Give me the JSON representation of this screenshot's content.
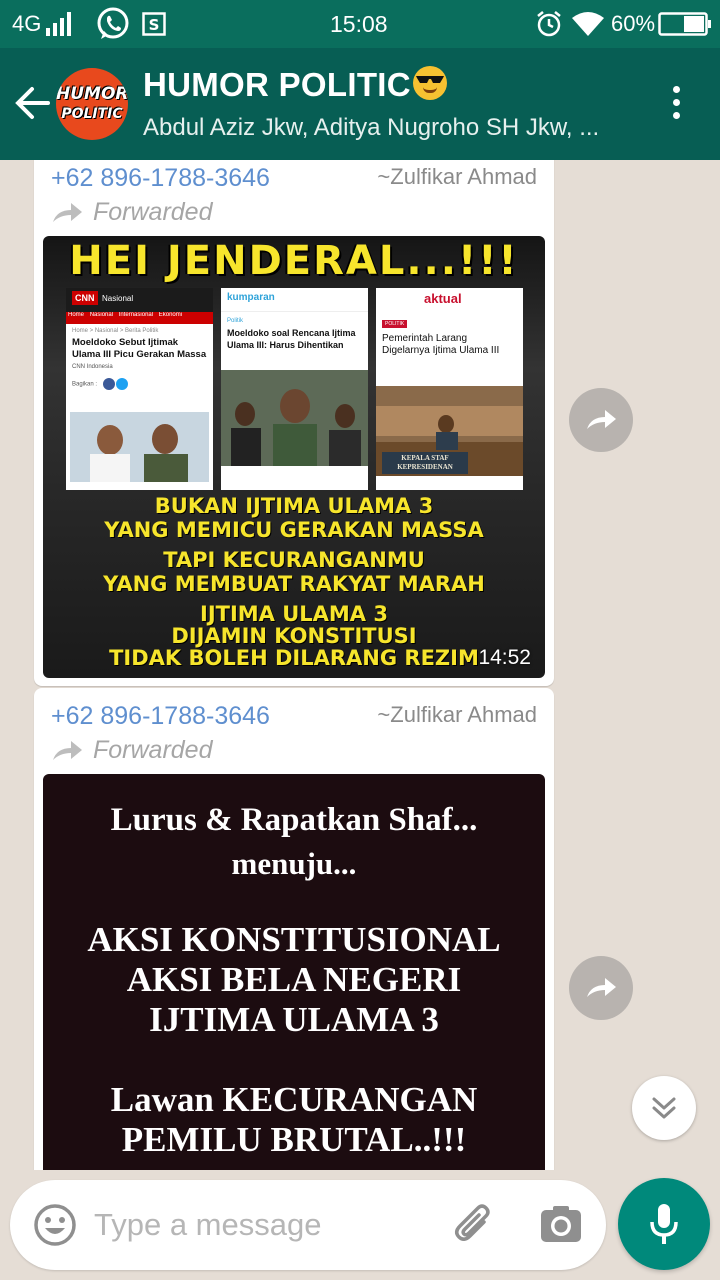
{
  "status_bar": {
    "network": "4G",
    "time": "15:08",
    "battery": "60%"
  },
  "header": {
    "title": "HUMOR POLITIC",
    "avatar_text_1": "HUMOR",
    "avatar_text_2": "POLITIC",
    "subtitle": "Abdul Aziz Jkw, Aditya Nugroho SH Jkw, ..."
  },
  "messages": [
    {
      "sender_phone": "+62 896-1788-3646",
      "sender_name": "~Zulfikar Ahmad",
      "forwarded_label": "Forwarded",
      "time": "14:52",
      "image": {
        "headline": "HEI JENDERAL...!!!",
        "cards": [
          {
            "outlet": "CNN",
            "section": "Nasional",
            "nav": [
              "Home",
              "Nasional",
              "Internasional",
              "Ekonomi"
            ],
            "breadcrumb": "Home > Nasional > Berita Politik",
            "headline": "Moeldoko Sebut Ijtimak Ulama III Picu Gerakan Massa",
            "source": "CNN Indonesia",
            "share_label": "Bagikan :"
          },
          {
            "outlet": "kumparan",
            "tag": "Politik",
            "headline": "Moeldoko soal Rencana Ijtima Ulama III: Harus Dihentikan"
          },
          {
            "outlet": "aktual",
            "tag": "POLITIK",
            "headline": "Pemerintah Larang Digelarnya Ijtima Ulama III",
            "sign": "KEPALA STAF KEPRESIDENAN"
          }
        ],
        "captions": [
          "BUKAN IJTIMA ULAMA 3",
          "YANG MEMICU GERAKAN MASSA",
          "TAPI KECURANGANMU",
          "YANG MEMBUAT RAKYAT MARAH",
          "IJTIMA ULAMA 3",
          "DIJAMIN KONSTITUSI",
          "TIDAK BOLEH DILARANG REZIM"
        ]
      }
    },
    {
      "sender_phone": "+62 896-1788-3646",
      "sender_name": "~Zulfikar Ahmad",
      "forwarded_label": "Forwarded",
      "image": {
        "lines": [
          "Lurus & Rapatkan Shaf...",
          "menuju...",
          "AKSI KONSTITUSIONAL",
          "AKSI BELA NEGERI",
          "IJTIMA ULAMA 3",
          "Lawan KECURANGAN",
          "PEMILU BRUTAL..!!!"
        ]
      }
    }
  ],
  "composer": {
    "placeholder": "Type a message"
  },
  "colors": {
    "header": "#075e54",
    "status_bar": "#0a6e5d",
    "accent": "#00897b",
    "chat_bg": "#e5ddd5",
    "sender": "#5f8fcf",
    "poster_yellow": "#f7e52c"
  },
  "icons": [
    "signal-icon",
    "whatsapp-icon",
    "s-icon",
    "alarm-icon",
    "wifi-icon",
    "battery-icon",
    "back-arrow-icon",
    "more-vert-icon",
    "forward-icon",
    "chevron-double-down-icon",
    "emoji-icon",
    "paperclip-icon",
    "camera-icon",
    "mic-icon"
  ]
}
